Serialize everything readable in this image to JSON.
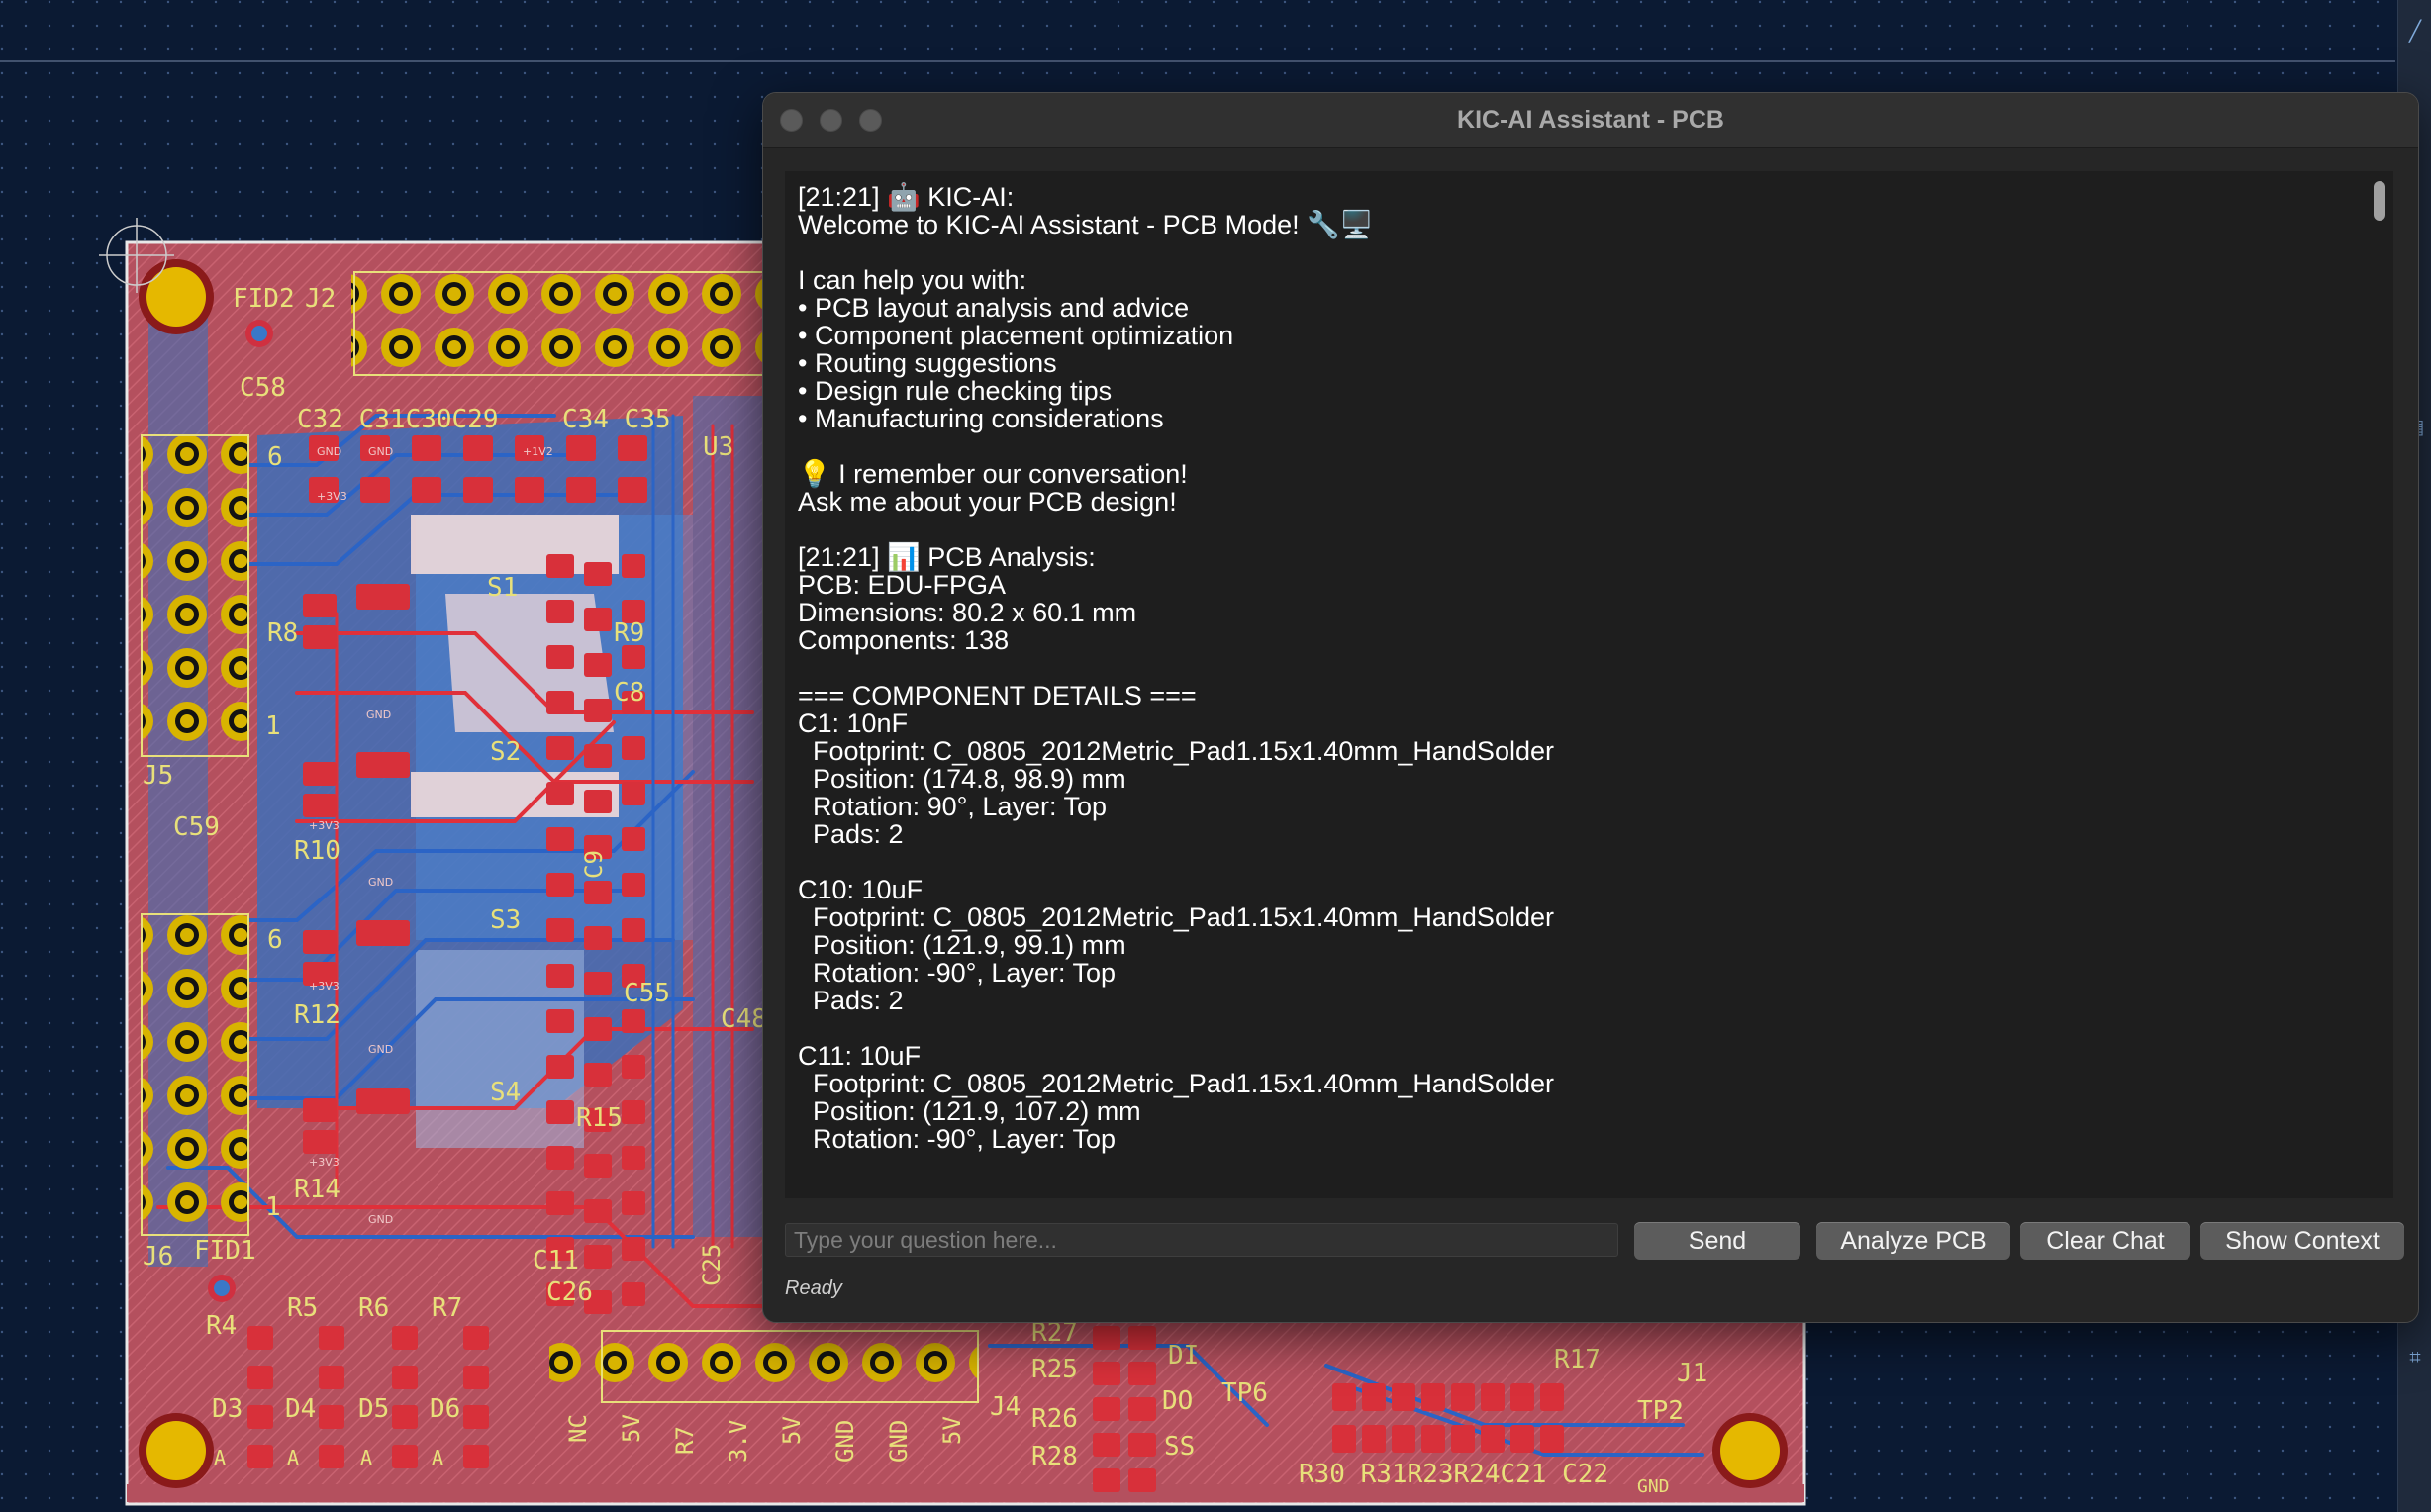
{
  "pcb": {
    "labels": {
      "fid2": "FID2",
      "j2": "J2",
      "c58": "C58",
      "c_row": "C32 C31C30C29",
      "c34": "C34 C35",
      "u3": "U3",
      "r8": "R8",
      "r9": "R9",
      "c8": "C8",
      "s1": "S1",
      "s2": "S2",
      "s3": "S3",
      "s4": "S4",
      "j5": "J5",
      "c59": "C59",
      "r10": "R10",
      "r12": "R12",
      "r14": "R14",
      "c9": "C9",
      "c55": "C55",
      "c48": "C48",
      "r15": "R15",
      "c11": "C11",
      "c26": "C26",
      "c25": "C25",
      "j6": "J6",
      "fid1": "FID1",
      "r4": "R4",
      "r5": "R5",
      "r6": "R6",
      "r7": "R7",
      "d3": "D3",
      "d4": "D4",
      "d5": "D5",
      "d6": "D6",
      "a": "A",
      "nc": "NC",
      "5v": "5V",
      "gnd": "GND",
      "j4": "J4",
      "3v": "3.V",
      "r27": "R27",
      "r25": "R25",
      "r26": "R26",
      "r28": "R28",
      "di": "DI",
      "do": "DO",
      "ss": "SS",
      "tp6": "TP6",
      "r17": "R17",
      "j1": "J1",
      "tp2": "TP2",
      "bottom_row": "R30 R31R23R24C21 C22",
      "pin6": "6",
      "pin1": "1",
      "net_gnd": "GND",
      "net_3v3": "+3V3",
      "net_1v2": "+1V2"
    }
  },
  "window": {
    "title": "KIC-AI Assistant - PCB",
    "chat_text": "[21:21] 🤖 KIC-AI:\nWelcome to KIC-AI Assistant - PCB Mode! 🔧🖥️\n\nI can help you with:\n• PCB layout analysis and advice\n• Component placement optimization\n• Routing suggestions\n• Design rule checking tips\n• Manufacturing considerations\n\n💡 I remember our conversation!\nAsk me about your PCB design!\n\n[21:21] 📊 PCB Analysis:\nPCB: EDU-FPGA\nDimensions: 80.2 x 60.1 mm\nComponents: 138\n\n=== COMPONENT DETAILS ===\nC1: 10nF\n  Footprint: C_0805_2012Metric_Pad1.15x1.40mm_HandSolder\n  Position: (174.8, 98.9) mm\n  Rotation: 90°, Layer: Top\n  Pads: 2\n\nC10: 10uF\n  Footprint: C_0805_2012Metric_Pad1.15x1.40mm_HandSolder\n  Position: (121.9, 99.1) mm\n  Rotation: -90°, Layer: Top\n  Pads: 2\n\nC11: 10uF\n  Footprint: C_0805_2012Metric_Pad1.15x1.40mm_HandSolder\n  Position: (121.9, 107.2) mm\n  Rotation: -90°, Layer: Top",
    "input_placeholder": "Type your question here...",
    "buttons": {
      "send": "Send",
      "analyze": "Analyze PCB",
      "clear": "Clear Chat",
      "context": "Show Context"
    },
    "status": "Ready"
  },
  "colors": {
    "board": "#b8505c",
    "copper_top": "#c8323c",
    "copper_bottom": "#3a78c8",
    "silkscreen": "#e8e07a",
    "pad_gold": "#e5b800"
  }
}
